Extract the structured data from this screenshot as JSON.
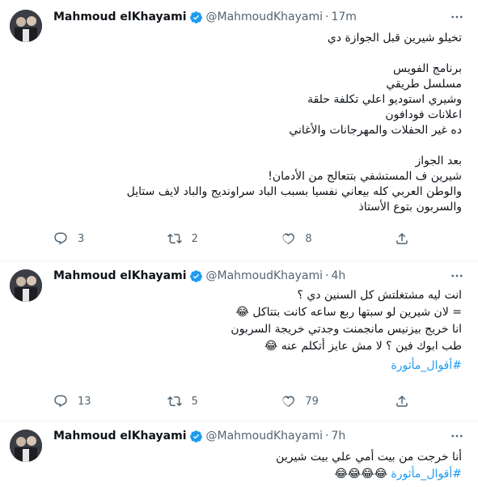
{
  "tweets": [
    {
      "author": {
        "name": "Mahmoud elKhayami",
        "handle": "@MahmoudKhayami",
        "time": "17m"
      },
      "lines": [
        "تخيلو شيرين قبل الجوازة دي",
        "",
        "برنامج الفويس",
        "مسلسل طريقي",
        "وشيري استوديو اعلي تكلفة حلقة",
        "اعلانات فودافون",
        "ده غير الحفلات والمهرجانات  والأغاني",
        "",
        "بعد الجواز",
        "شيرين ف المستشفي بتتعالج من الأدمان!",
        "والوطن العربي كله بيعاني نفسيا بسبب الباد سراونديج والباد لايف ستايل",
        "والسربون بتوع الأستاذ"
      ],
      "hashtag": "",
      "replies": "3",
      "retweets": "2",
      "likes": "8"
    },
    {
      "author": {
        "name": "Mahmoud elKhayami",
        "handle": "@MahmoudKhayami",
        "time": "4h"
      },
      "lines": [
        "انت ليه مشتغلتش كل السنين دي ؟",
        "= لان شيرين لو سبتها ربع ساعه كانت بتتاكل 😂",
        "انا خريج بيزنيس مانجمنت وجدتي خريجة السربون",
        "طب ابوك فين ؟ لا مش عايز أتكلم عنه 😂"
      ],
      "hashtag": "#أقوال_مأثورة",
      "replies": "13",
      "retweets": "5",
      "likes": "79"
    },
    {
      "author": {
        "name": "Mahmoud elKhayami",
        "handle": "@MahmoudKhayami",
        "time": "7h"
      },
      "lines": [
        "أنا خرجت من بيت أمي علي بيت شيرين"
      ],
      "hashtag": "#أقوال_مأثورة",
      "hashtag_suffix": " 😂😂😂😂",
      "replies": "",
      "retweets": "",
      "likes": ""
    }
  ],
  "colors": {
    "text": "#0f1419",
    "secondary": "#536471",
    "link": "#1d9bf0",
    "divider": "#eff3f4"
  },
  "icons": [
    "verified-badge-icon",
    "more-icon",
    "reply-icon",
    "retweet-icon",
    "like-icon",
    "share-icon"
  ]
}
